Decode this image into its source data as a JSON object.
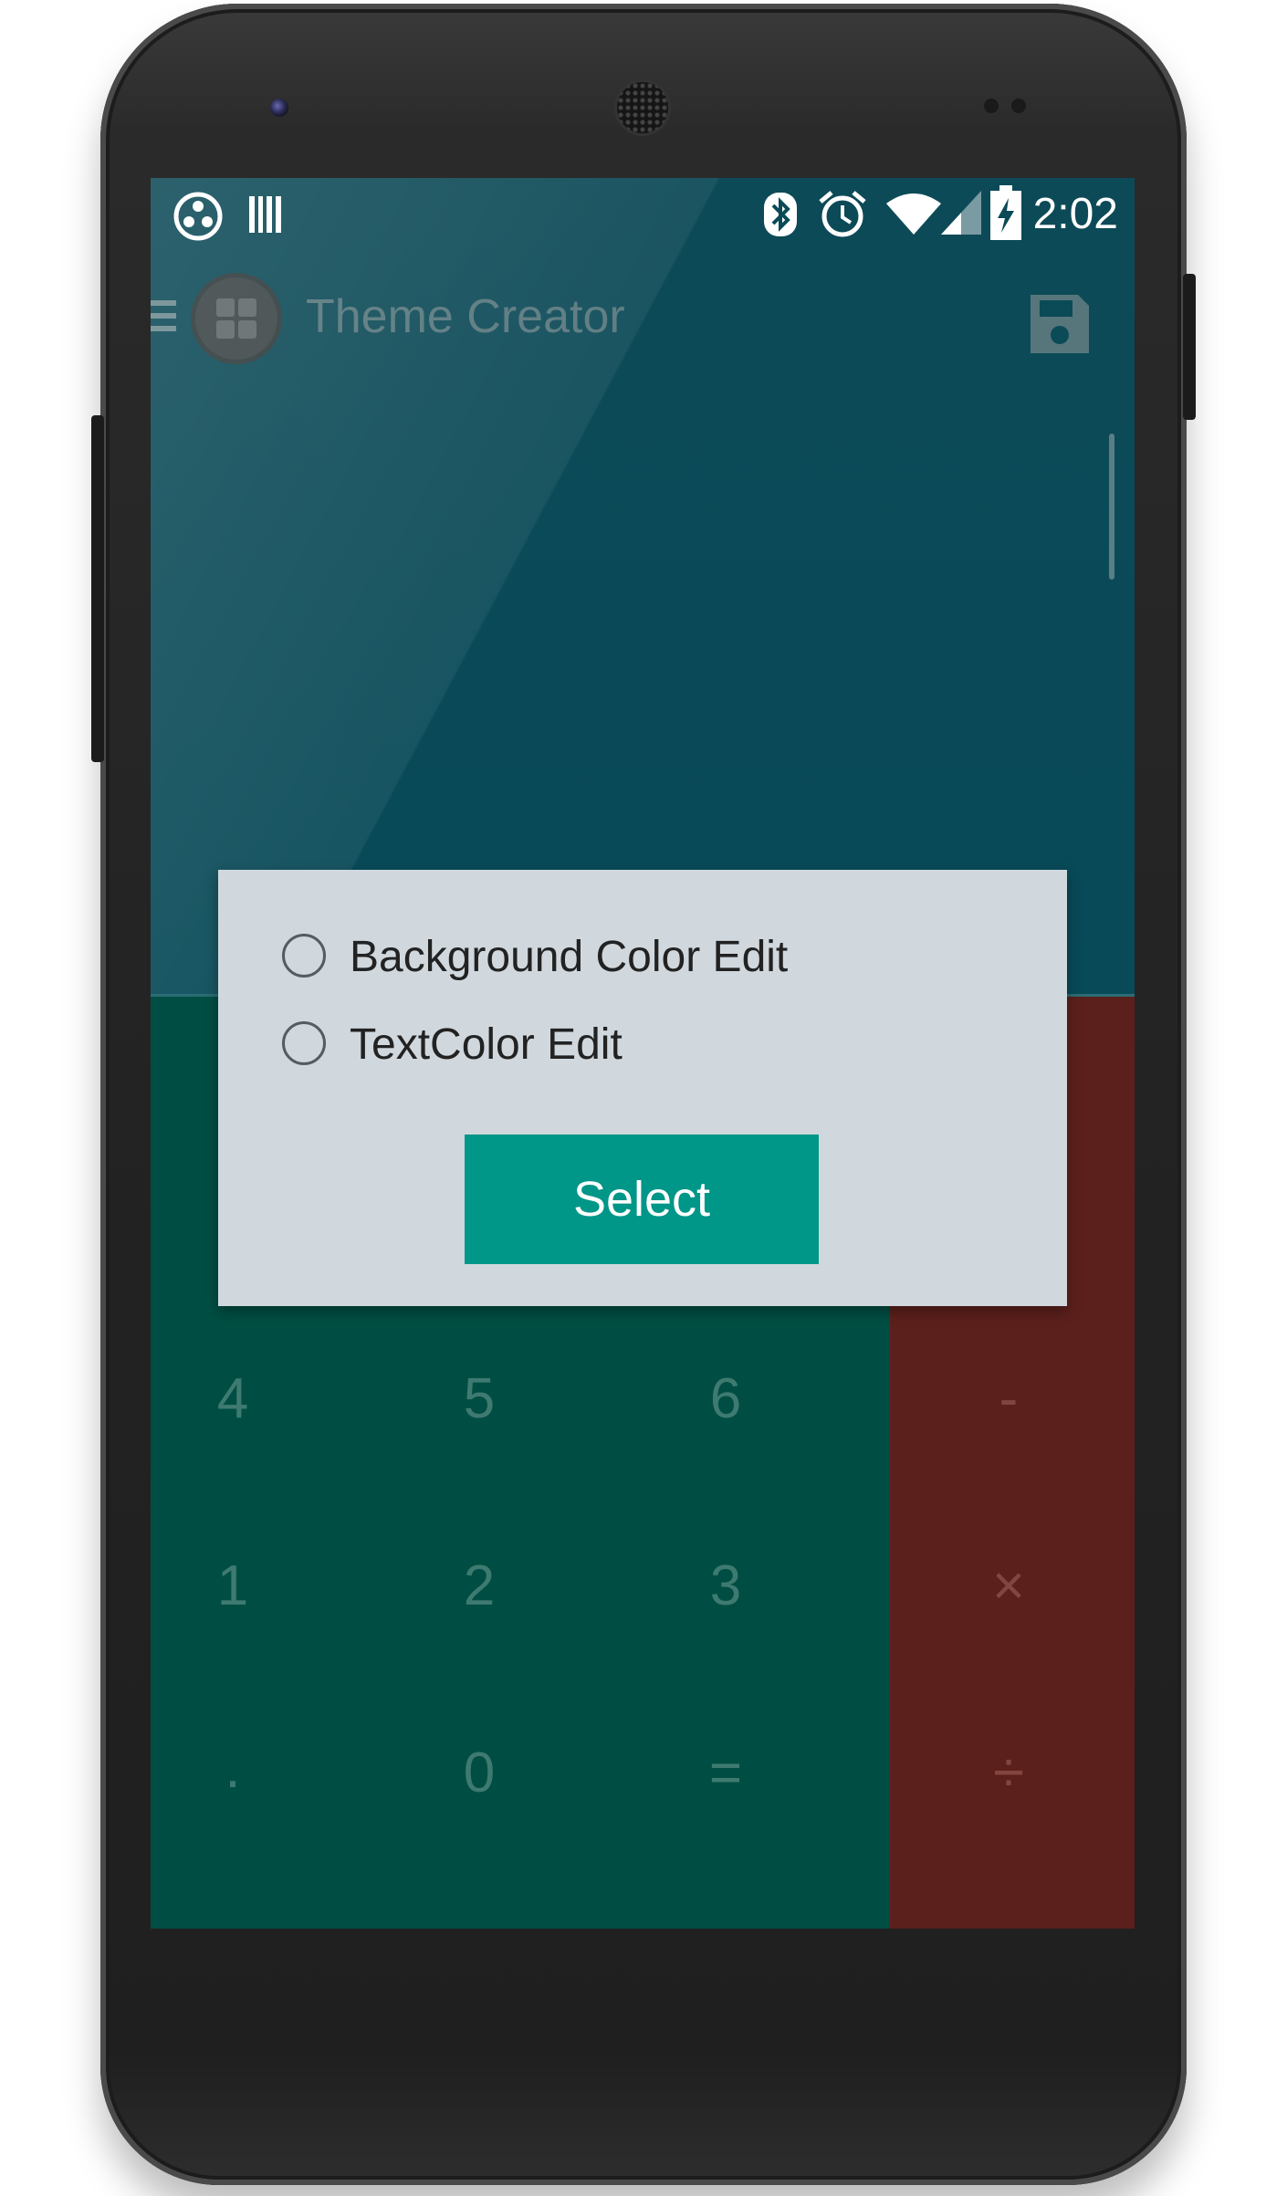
{
  "status_bar": {
    "time": "2:02",
    "left_icons": [
      "app-icon",
      "barcode-icon"
    ],
    "right_icons": [
      "bluetooth-icon",
      "alarm-icon",
      "wifi-icon",
      "signal-icon",
      "battery-charging-icon"
    ]
  },
  "app_bar": {
    "title": "Theme Creator",
    "icons": [
      "menu-icon",
      "app-logo-icon",
      "save-icon"
    ]
  },
  "keypad": {
    "row1": [
      "4",
      "5",
      "6",
      "-"
    ],
    "row2": [
      "1",
      "2",
      "3",
      "×"
    ],
    "row3": [
      ".",
      "0",
      "=",
      "÷"
    ]
  },
  "dialog": {
    "options": [
      "Background Color Edit",
      "TextColor Edit"
    ],
    "selected_option": null,
    "button_label": "Select"
  },
  "colors": {
    "display_bg": "#084a58",
    "keypad_bg": "#004e43",
    "operators_bg": "#5c201c",
    "dialog_bg": "#d0d8de",
    "accent": "#009688"
  }
}
